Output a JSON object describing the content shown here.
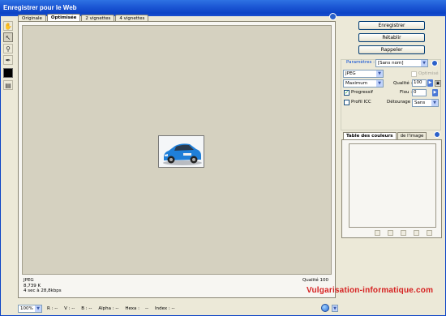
{
  "window": {
    "title": "Enregistrer pour le Web"
  },
  "tools": [
    {
      "name": "hand-tool-icon",
      "glyph": "✋"
    },
    {
      "name": "slice-select-tool-icon",
      "glyph": "⬏"
    },
    {
      "name": "zoom-tool-icon",
      "glyph": "🔍"
    },
    {
      "name": "eyedropper-tool-icon",
      "glyph": "⁄"
    }
  ],
  "view_tabs": [
    {
      "label": "Originale",
      "active": false
    },
    {
      "label": "Optimisée",
      "active": true
    },
    {
      "label": "2 vignettes",
      "active": false
    },
    {
      "label": "4 vignettes",
      "active": false
    }
  ],
  "image_info": {
    "format": "JPEG",
    "size": "8,739 K",
    "download": "4 sec à 28,8kbps",
    "quality": "Qualité 100"
  },
  "watermark": "Vulgarisation-informatique.com",
  "status_bar": {
    "zoom": "100%",
    "readouts": [
      {
        "label": "R :",
        "value": "--"
      },
      {
        "label": "V :",
        "value": "--"
      },
      {
        "label": "B :",
        "value": "--"
      },
      {
        "label": "Alpha :",
        "value": "--"
      },
      {
        "label": "Hexa :",
        "value": "--"
      },
      {
        "label": "Index :",
        "value": "--"
      }
    ]
  },
  "actions": {
    "save": "Enregistrer",
    "reset": "Rétablir",
    "recall": "Rappeler"
  },
  "settings": {
    "group_label": "Paramètres :",
    "preset": "[Sans nom]",
    "format": "JPEG",
    "optimized_label": "Optimisé",
    "quality_preset": "Maximum",
    "quality_label": "Qualité :",
    "quality_value": "100",
    "progressive_label": "Progressif",
    "progressive_checked": true,
    "blur_label": "Flou :",
    "blur_value": "0",
    "icc_label": "Profil ICC",
    "icc_checked": false,
    "matte_label": "Détourage :",
    "matte_value": "Sans"
  },
  "color_table": {
    "tabs": [
      {
        "label": "Table des couleurs",
        "active": true
      },
      {
        "label": "de l'image",
        "active": false
      }
    ]
  },
  "colors": {
    "title_bar": "#0c44c6",
    "watermark": "#d62020",
    "canvas_bg": "#d5d1c0"
  }
}
